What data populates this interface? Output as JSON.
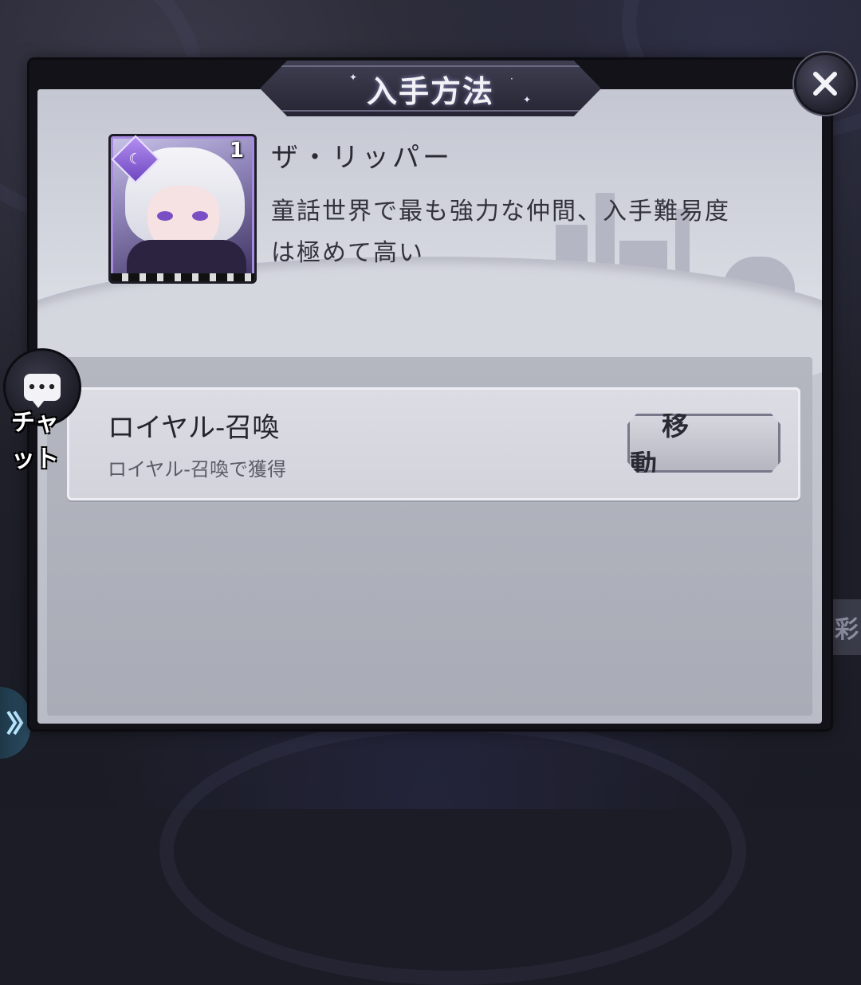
{
  "dialog": {
    "title": "入手方法",
    "close_icon": "close-icon"
  },
  "character": {
    "name": "ザ・リッパー",
    "description": "童話世界で最も強力な仲間、入手難易度は極めて高い",
    "level": "1",
    "element_icon": "moon-element-icon"
  },
  "sources": [
    {
      "title": "ロイヤル-召喚",
      "subtitle": "ロイヤル-召喚で獲得",
      "button_label": "移動"
    }
  ],
  "chat": {
    "label": "チャット",
    "icon": "speech-bubble-icon",
    "icon_text": "•••"
  },
  "background": {
    "side_text": "彩"
  },
  "colors": {
    "panel": "#cdd0d9",
    "frame": "#121218",
    "title_plate": "#2f2f40",
    "accent_purple": "#8e6ad8"
  }
}
